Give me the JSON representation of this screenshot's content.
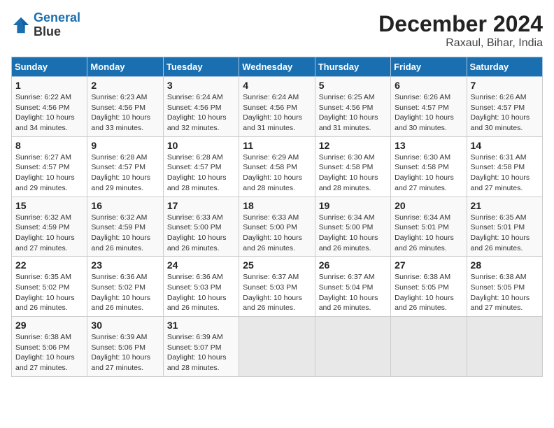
{
  "logo": {
    "line1": "General",
    "line2": "Blue"
  },
  "title": "December 2024",
  "subtitle": "Raxaul, Bihar, India",
  "weekdays": [
    "Sunday",
    "Monday",
    "Tuesday",
    "Wednesday",
    "Thursday",
    "Friday",
    "Saturday"
  ],
  "weeks": [
    [
      {
        "day": "1",
        "sunrise": "6:22 AM",
        "sunset": "4:56 PM",
        "daylight": "10 hours and 34 minutes."
      },
      {
        "day": "2",
        "sunrise": "6:23 AM",
        "sunset": "4:56 PM",
        "daylight": "10 hours and 33 minutes."
      },
      {
        "day": "3",
        "sunrise": "6:24 AM",
        "sunset": "4:56 PM",
        "daylight": "10 hours and 32 minutes."
      },
      {
        "day": "4",
        "sunrise": "6:24 AM",
        "sunset": "4:56 PM",
        "daylight": "10 hours and 31 minutes."
      },
      {
        "day": "5",
        "sunrise": "6:25 AM",
        "sunset": "4:56 PM",
        "daylight": "10 hours and 31 minutes."
      },
      {
        "day": "6",
        "sunrise": "6:26 AM",
        "sunset": "4:57 PM",
        "daylight": "10 hours and 30 minutes."
      },
      {
        "day": "7",
        "sunrise": "6:26 AM",
        "sunset": "4:57 PM",
        "daylight": "10 hours and 30 minutes."
      }
    ],
    [
      {
        "day": "8",
        "sunrise": "6:27 AM",
        "sunset": "4:57 PM",
        "daylight": "10 hours and 29 minutes."
      },
      {
        "day": "9",
        "sunrise": "6:28 AM",
        "sunset": "4:57 PM",
        "daylight": "10 hours and 29 minutes."
      },
      {
        "day": "10",
        "sunrise": "6:28 AM",
        "sunset": "4:57 PM",
        "daylight": "10 hours and 28 minutes."
      },
      {
        "day": "11",
        "sunrise": "6:29 AM",
        "sunset": "4:58 PM",
        "daylight": "10 hours and 28 minutes."
      },
      {
        "day": "12",
        "sunrise": "6:30 AM",
        "sunset": "4:58 PM",
        "daylight": "10 hours and 28 minutes."
      },
      {
        "day": "13",
        "sunrise": "6:30 AM",
        "sunset": "4:58 PM",
        "daylight": "10 hours and 27 minutes."
      },
      {
        "day": "14",
        "sunrise": "6:31 AM",
        "sunset": "4:58 PM",
        "daylight": "10 hours and 27 minutes."
      }
    ],
    [
      {
        "day": "15",
        "sunrise": "6:32 AM",
        "sunset": "4:59 PM",
        "daylight": "10 hours and 27 minutes."
      },
      {
        "day": "16",
        "sunrise": "6:32 AM",
        "sunset": "4:59 PM",
        "daylight": "10 hours and 26 minutes."
      },
      {
        "day": "17",
        "sunrise": "6:33 AM",
        "sunset": "5:00 PM",
        "daylight": "10 hours and 26 minutes."
      },
      {
        "day": "18",
        "sunrise": "6:33 AM",
        "sunset": "5:00 PM",
        "daylight": "10 hours and 26 minutes."
      },
      {
        "day": "19",
        "sunrise": "6:34 AM",
        "sunset": "5:00 PM",
        "daylight": "10 hours and 26 minutes."
      },
      {
        "day": "20",
        "sunrise": "6:34 AM",
        "sunset": "5:01 PM",
        "daylight": "10 hours and 26 minutes."
      },
      {
        "day": "21",
        "sunrise": "6:35 AM",
        "sunset": "5:01 PM",
        "daylight": "10 hours and 26 minutes."
      }
    ],
    [
      {
        "day": "22",
        "sunrise": "6:35 AM",
        "sunset": "5:02 PM",
        "daylight": "10 hours and 26 minutes."
      },
      {
        "day": "23",
        "sunrise": "6:36 AM",
        "sunset": "5:02 PM",
        "daylight": "10 hours and 26 minutes."
      },
      {
        "day": "24",
        "sunrise": "6:36 AM",
        "sunset": "5:03 PM",
        "daylight": "10 hours and 26 minutes."
      },
      {
        "day": "25",
        "sunrise": "6:37 AM",
        "sunset": "5:03 PM",
        "daylight": "10 hours and 26 minutes."
      },
      {
        "day": "26",
        "sunrise": "6:37 AM",
        "sunset": "5:04 PM",
        "daylight": "10 hours and 26 minutes."
      },
      {
        "day": "27",
        "sunrise": "6:38 AM",
        "sunset": "5:05 PM",
        "daylight": "10 hours and 26 minutes."
      },
      {
        "day": "28",
        "sunrise": "6:38 AM",
        "sunset": "5:05 PM",
        "daylight": "10 hours and 27 minutes."
      }
    ],
    [
      {
        "day": "29",
        "sunrise": "6:38 AM",
        "sunset": "5:06 PM",
        "daylight": "10 hours and 27 minutes."
      },
      {
        "day": "30",
        "sunrise": "6:39 AM",
        "sunset": "5:06 PM",
        "daylight": "10 hours and 27 minutes."
      },
      {
        "day": "31",
        "sunrise": "6:39 AM",
        "sunset": "5:07 PM",
        "daylight": "10 hours and 28 minutes."
      },
      null,
      null,
      null,
      null
    ]
  ]
}
